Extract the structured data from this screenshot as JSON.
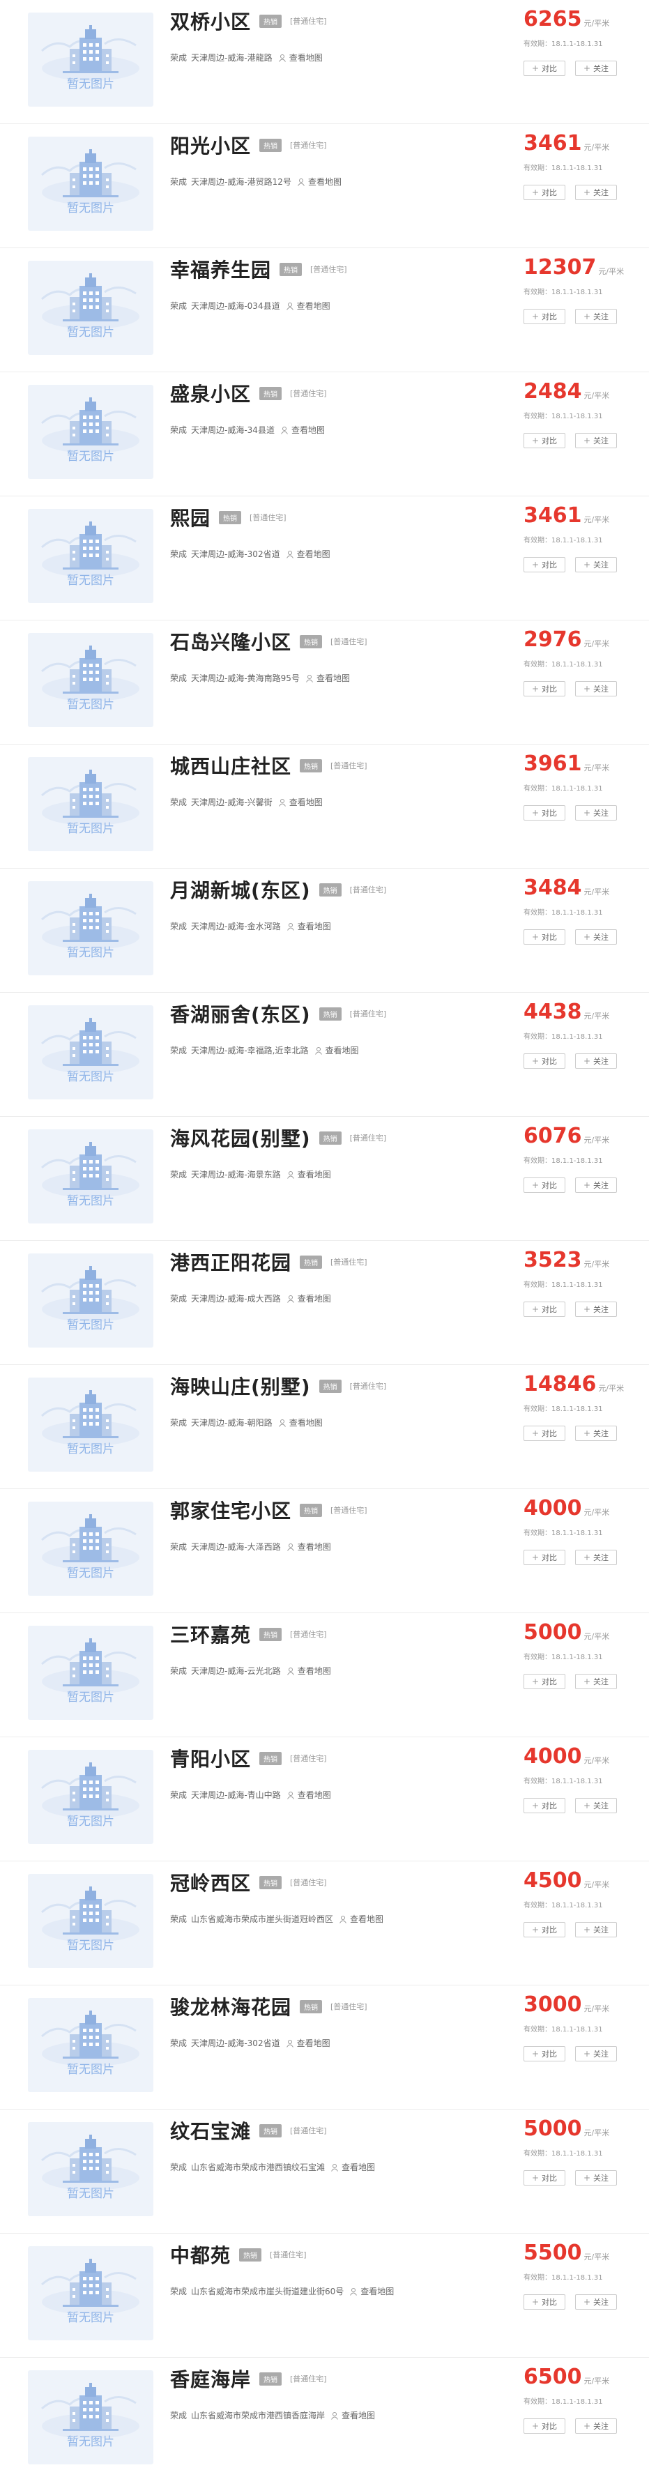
{
  "placeholder_text": "暂无图片",
  "tag_label": "热销",
  "type_label": "[普通住宅]",
  "city_prefix": "荣成",
  "map_label": "查看地图",
  "unit_label": "元/平米",
  "validity_text": "有效期：18.1.1-18.1.31",
  "compare_label": "对比",
  "follow_label": "关注",
  "colors": {
    "price": "#e6372d",
    "tag_bg": "#aaaaaa",
    "placeholder_bg": "#eef3fa",
    "placeholder_text": "#8fb4e8"
  },
  "listings": [
    {
      "name": "双桥小区",
      "address": "天津周边-威海-港龍路",
      "price": "6265"
    },
    {
      "name": "阳光小区",
      "address": "天津周边-威海-港贸路12号",
      "price": "3461"
    },
    {
      "name": "幸福养生园",
      "address": "天津周边-威海-034县道",
      "price": "12307"
    },
    {
      "name": "盛泉小区",
      "address": "天津周边-威海-34县道",
      "price": "2484"
    },
    {
      "name": "熙园",
      "address": "天津周边-威海-302省道",
      "price": "3461"
    },
    {
      "name": "石岛兴隆小区",
      "address": "天津周边-威海-黄海南路95号",
      "price": "2976"
    },
    {
      "name": "城西山庄社区",
      "address": "天津周边-威海-兴馨街",
      "price": "3961"
    },
    {
      "name": "月湖新城(东区)",
      "address": "天津周边-威海-金水河路",
      "price": "3484"
    },
    {
      "name": "香湖丽舍(东区)",
      "address": "天津周边-威海-幸福路,近幸北路",
      "price": "4438"
    },
    {
      "name": "海风花园(别墅)",
      "address": "天津周边-威海-海景东路",
      "price": "6076"
    },
    {
      "name": "港西正阳花园",
      "address": "天津周边-威海-成大西路",
      "price": "3523"
    },
    {
      "name": "海映山庄(别墅)",
      "address": "天津周边-威海-朝阳路",
      "price": "14846"
    },
    {
      "name": "郭家住宅小区",
      "address": "天津周边-威海-大泽西路",
      "price": "4000"
    },
    {
      "name": "三环嘉苑",
      "address": "天津周边-威海-云光北路",
      "price": "5000"
    },
    {
      "name": "青阳小区",
      "address": "天津周边-威海-青山中路",
      "price": "4000"
    },
    {
      "name": "冠岭西区",
      "address": "山东省威海市荣成市崖头街道冠岭西区",
      "price": "4500"
    },
    {
      "name": "骏龙林海花园",
      "address": "天津周边-威海-302省道",
      "price": "3000"
    },
    {
      "name": "纹石宝滩",
      "address": "山东省威海市荣成市港西镇纹石宝滩",
      "price": "5000"
    },
    {
      "name": "中都苑",
      "address": "山东省威海市荣成市崖头街道建业街60号",
      "price": "5500"
    },
    {
      "name": "香庭海岸",
      "address": "山东省威海市荣成市港西镇香庭海岸",
      "price": "6500"
    }
  ]
}
